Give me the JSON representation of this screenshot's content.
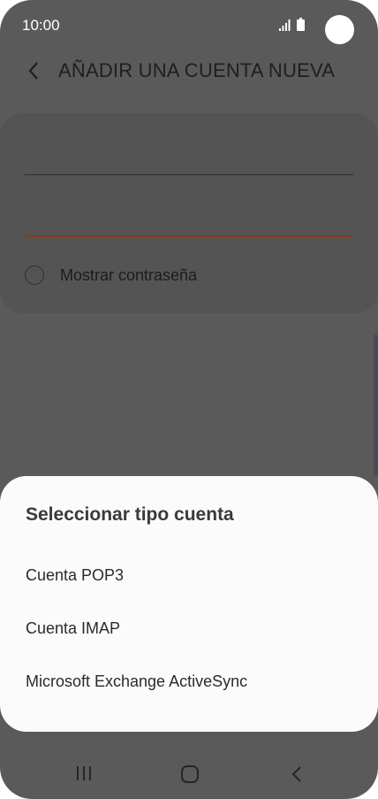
{
  "status_bar": {
    "time": "10:00",
    "icons": [
      "signal-icon",
      "battery-icon",
      "front-camera"
    ]
  },
  "header": {
    "back_icon": "chevron-left-icon",
    "title": "AÑADIR UNA CUENTA NUEVA"
  },
  "form": {
    "show_password_label": "Mostrar contraseña",
    "show_password_checked": false,
    "active_field_color": "#8a3a1e"
  },
  "sheet": {
    "title": "Seleccionar tipo cuenta",
    "options": [
      {
        "label": "Cuenta POP3"
      },
      {
        "label": "Cuenta IMAP"
      },
      {
        "label": "Microsoft Exchange ActiveSync"
      }
    ]
  },
  "nav_bar": {
    "icons": [
      "recent-apps-icon",
      "home-icon",
      "back-icon"
    ]
  },
  "colors": {
    "scrim": "#5a5a5a",
    "sheet_background": "#fbfbfb"
  }
}
